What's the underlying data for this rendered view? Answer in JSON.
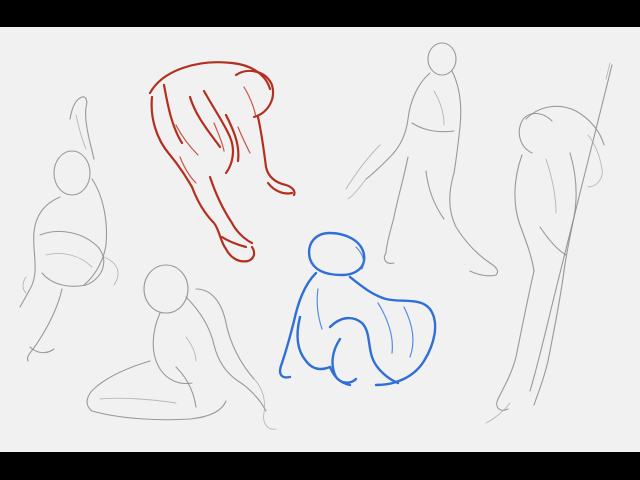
{
  "image": {
    "description_colors": {
      "letterbox": "#000000",
      "paper": "#f1f1f1",
      "pencil": "#8a8a8a",
      "red_chalk": "#b3301f",
      "blue_pencil": "#2f6fd6"
    }
  }
}
